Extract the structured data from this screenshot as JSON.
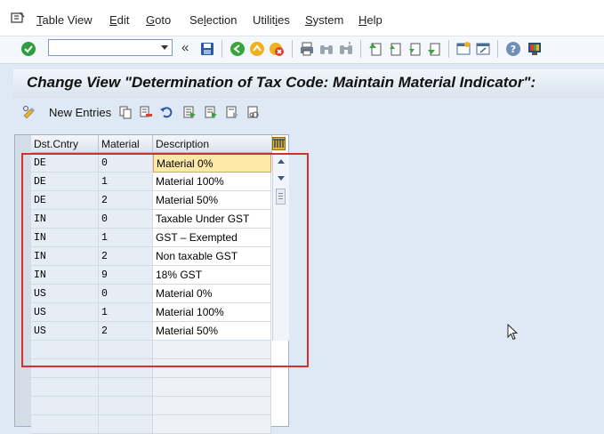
{
  "menubar": {
    "items": [
      {
        "label": "Table View",
        "key": "T",
        "rest": "able View"
      },
      {
        "label": "Edit",
        "key": "E",
        "rest": "dit"
      },
      {
        "label": "Goto",
        "key": "G",
        "rest": "oto"
      },
      {
        "label": "Selection",
        "key": "",
        "pre": "Se",
        "key2": "l",
        "rest2": "ection"
      },
      {
        "label": "Utilities",
        "pre": "Utilit",
        "key2": "i",
        "rest2": "es"
      },
      {
        "label": "System",
        "key": "S",
        "rest": "ystem"
      },
      {
        "label": "Help",
        "key": "H",
        "rest": "elp"
      }
    ]
  },
  "toolbar": {
    "command_field": {
      "value": "",
      "placeholder": ""
    },
    "colors": {
      "enter_green": "#2e9e3e",
      "save_blue": "#2a5aa5",
      "exit_yellow": "#f0b020",
      "cancel_red": "#d9412f"
    }
  },
  "title": {
    "text": "Change View \"Determination of Tax Code: Maintain Material Indicator\":"
  },
  "app_toolbar": {
    "new_entries_label": "New Entries"
  },
  "table": {
    "columns": [
      "Dst.Cntry",
      "Material",
      "Description"
    ],
    "rows": [
      [
        "DE",
        "0",
        "Material 0%"
      ],
      [
        "DE",
        "1",
        "Material 100%"
      ],
      [
        "DE",
        "2",
        "Material 50%"
      ],
      [
        "IN",
        "0",
        "Taxable Under GST"
      ],
      [
        "IN",
        "1",
        "GST – Exempted"
      ],
      [
        "IN",
        "2",
        "Non taxable GST"
      ],
      [
        "IN",
        "9",
        "18% GST"
      ],
      [
        "US",
        "0",
        "Material 0%"
      ],
      [
        "US",
        "1",
        "Material 100%"
      ],
      [
        "US",
        "2",
        "Material 50%"
      ]
    ],
    "selected_row": 0,
    "highlight_color": "#d43030"
  }
}
